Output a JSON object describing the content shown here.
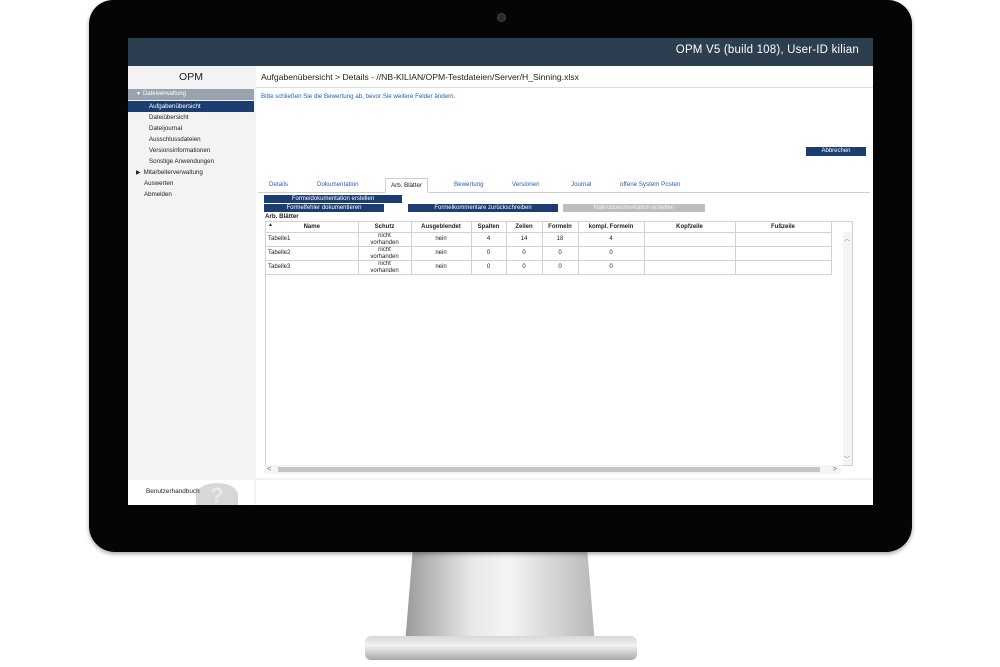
{
  "app_title": "OPM V5 (build 108), User-ID kilian",
  "sidebar": {
    "logo": "OPM",
    "group": "Dateiverwaltung",
    "sub_items": [
      {
        "label": "Aufgabenübersicht",
        "active": true
      },
      {
        "label": "Dateiübersicht",
        "active": false
      },
      {
        "label": "Dateijournal",
        "active": false
      },
      {
        "label": "Ausschlussdateien",
        "active": false
      },
      {
        "label": "Versionsinformationen",
        "active": false
      },
      {
        "label": "Sonstige Anwendungen",
        "active": false
      }
    ],
    "top_items": [
      {
        "label": "Mitarbeiterverwaltung",
        "expandable": true
      },
      {
        "label": "Auswerten",
        "expandable": false
      },
      {
        "label": "Abmelden",
        "expandable": false
      }
    ],
    "help_label": "Benutzerhandbuch",
    "help_icon": "question-mark-icon"
  },
  "main": {
    "breadcrumb": "Aufgabenübersicht > Details - //NB-KILIAN/OPM-Testdateien/Server/H_Sinning.xlsx",
    "info": "Bitte schließen Sie die Bewertung ab, bevor Sie weitere Felder ändern.",
    "cancel_label": "Abbrechen",
    "tabs": [
      {
        "label": "Details",
        "active": false
      },
      {
        "label": "Dokumentation",
        "active": false
      },
      {
        "label": "Arb. Blätter",
        "active": true
      },
      {
        "label": "Bewertung",
        "active": false
      },
      {
        "label": "Versionen",
        "active": false
      },
      {
        "label": "Journal",
        "active": false
      },
      {
        "label": "offene System Posten",
        "active": false
      }
    ],
    "buttons": {
      "formeldoku": "Formeldokumentation erstellen",
      "formelfehler": "Formelfehler dokumentieren",
      "formelkommentare": "Formelkommentare zurückschreiben",
      "makrodoku": "Makrodokumentation erstellen"
    },
    "section_label": "Arb. Blätter",
    "table": {
      "sort_indicator": "▲",
      "headers": [
        "Name",
        "Schutz",
        "Ausgeblendet",
        "Spalten",
        "Zeilen",
        "Formeln",
        "kompl. Formeln",
        "Kopfzeile",
        "Fußzeile"
      ],
      "rows": [
        {
          "name": "Tabelle1",
          "schutz_1": "nicht",
          "schutz_2": "vorhanden",
          "ausgeblendet": "nein",
          "spalten": "4",
          "zeilen": "14",
          "formeln": "18",
          "kompl": "4",
          "kopfzeile": "",
          "fusszeile": ""
        },
        {
          "name": "Tabelle2",
          "schutz_1": "nicht",
          "schutz_2": "vorhanden",
          "ausgeblendet": "nein",
          "spalten": "0",
          "zeilen": "0",
          "formeln": "0",
          "kompl": "0",
          "kopfzeile": "",
          "fusszeile": ""
        },
        {
          "name": "Tabelle3",
          "schutz_1": "nicht",
          "schutz_2": "vorhanden",
          "ausgeblendet": "nein",
          "spalten": "0",
          "zeilen": "0",
          "formeln": "0",
          "kompl": "0",
          "kopfzeile": "",
          "fusszeile": ""
        }
      ]
    }
  }
}
